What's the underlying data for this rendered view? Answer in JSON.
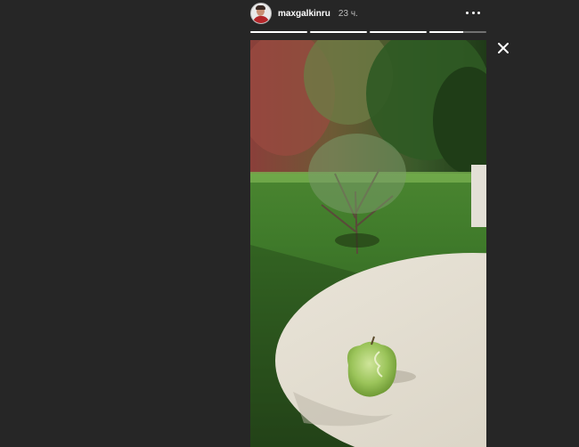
{
  "story": {
    "username": "maxgalkinru",
    "time_ago": "23 ч.",
    "segment_progress": [
      1,
      1,
      1,
      0.6
    ]
  },
  "icons": {
    "more": "more-horizontal-icon",
    "close": "close-icon"
  },
  "colors": {
    "background": "#262626",
    "progress_active": "#ffffff",
    "progress_inactive": "rgba(255,255,255,0.35)"
  }
}
